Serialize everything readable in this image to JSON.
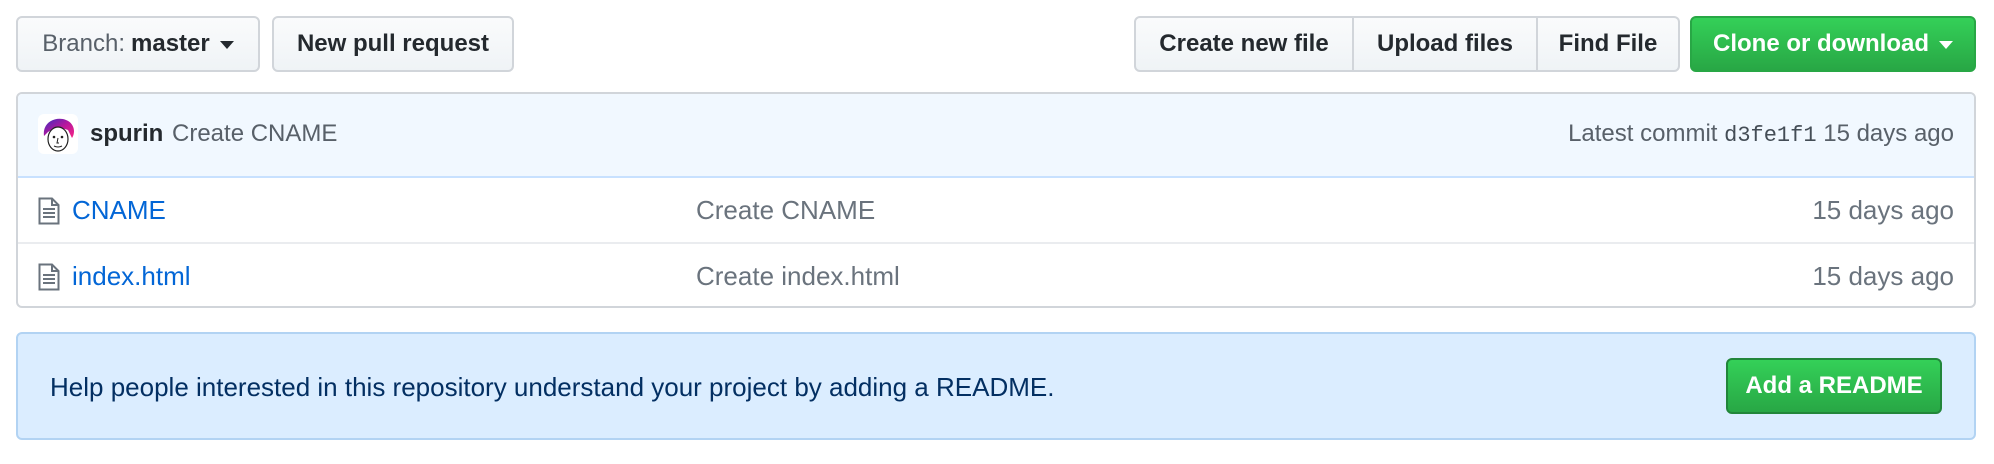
{
  "toolbar": {
    "branch_label": "Branch:",
    "branch_name": "master",
    "new_pr_label": "New pull request",
    "create_file_label": "Create new file",
    "upload_files_label": "Upload files",
    "find_file_label": "Find File",
    "clone_label": "Clone or download"
  },
  "commit": {
    "author": "spurin",
    "message": "Create CNAME",
    "latest_label": "Latest commit",
    "sha": "d3fe1f1",
    "age": "15 days ago"
  },
  "files": [
    {
      "name": "CNAME",
      "message": "Create CNAME",
      "age": "15 days ago",
      "icon": "file-icon"
    },
    {
      "name": "index.html",
      "message": "Create index.html",
      "age": "15 days ago",
      "icon": "file-icon"
    }
  ],
  "readme": {
    "text": "Help people interested in this repository understand your project by adding a README.",
    "button_label": "Add a README"
  },
  "colors": {
    "link": "#0366d6",
    "primary_green": "#28a745",
    "commit_bar_bg": "#f1f8ff",
    "banner_bg": "#dbedff"
  }
}
